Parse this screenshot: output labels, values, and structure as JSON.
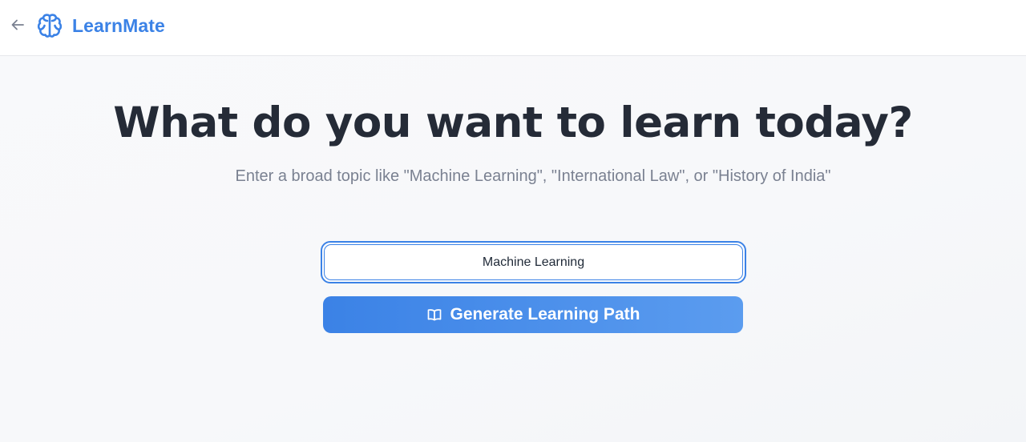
{
  "header": {
    "back_icon": "arrow-left-icon",
    "logo_icon": "brain-icon",
    "brand_name": "LearnMate",
    "brand_color": "#3b82e6"
  },
  "main": {
    "headline": "What do you want to learn today?",
    "subtitle": "Enter a broad topic like \"Machine Learning\", \"International Law\", or \"History of India\"",
    "topic_input": {
      "value": "Machine Learning"
    },
    "generate_button": {
      "label": "Generate Learning Path",
      "icon": "book-open-icon"
    }
  }
}
